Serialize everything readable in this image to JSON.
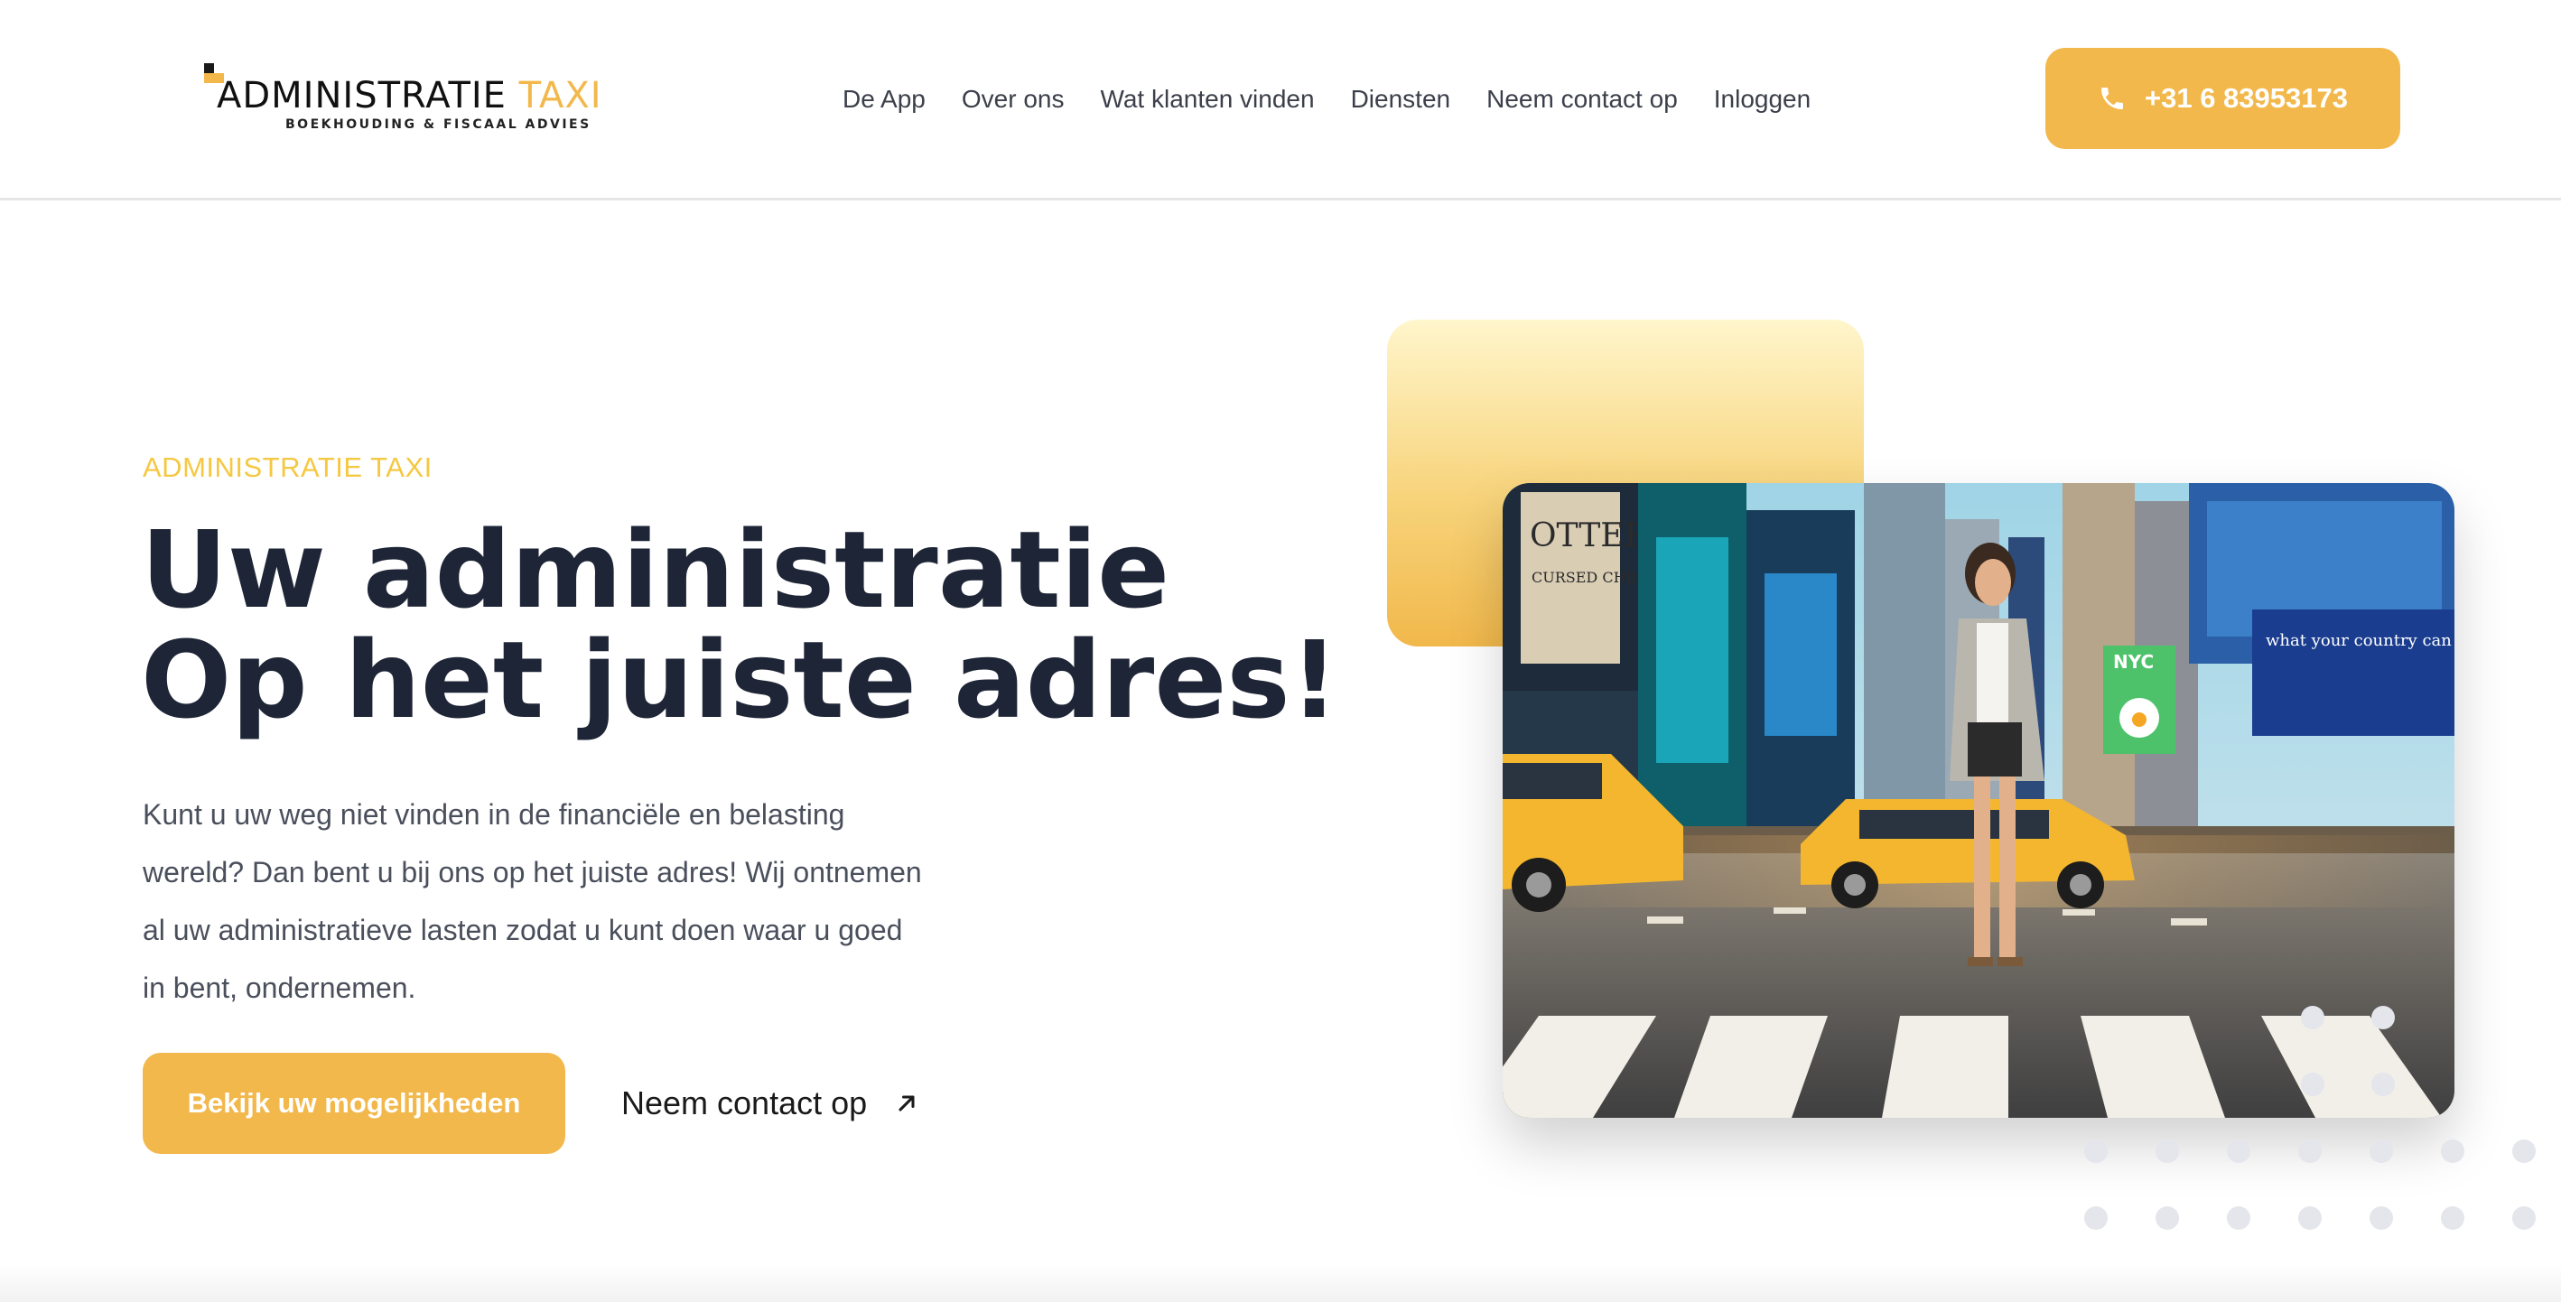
{
  "brand": {
    "name_part1": "ADMINISTRATIE",
    "name_part2": "TAXI",
    "tagline": "BOEKHOUDING & FISCAAL ADVIES",
    "accent_color": "#f2b84b"
  },
  "nav": {
    "items": [
      {
        "label": "De App"
      },
      {
        "label": "Over ons"
      },
      {
        "label": "Wat klanten vinden"
      },
      {
        "label": "Diensten"
      },
      {
        "label": "Neem contact op"
      },
      {
        "label": "Inloggen"
      }
    ]
  },
  "header": {
    "phone_label": "+31 6 83953173",
    "phone_icon": "phone-icon"
  },
  "hero": {
    "eyebrow": "ADMINISTRATIE TAXI",
    "title_line1": "Uw administratie",
    "title_line2": "Op het juiste adres!",
    "lead_lines": [
      "Kunt u uw weg niet vinden in de financiële en belasting",
      "wereld? Dan bent u bij ons op het juiste adres! Wij ontnemen",
      "al uw administratieve lasten zodat u kunt doen waar u goed",
      "in bent, ondernemen."
    ],
    "primary_cta": "Bekijk uw mogelijkheden",
    "secondary_cta": "Neem contact op",
    "secondary_icon": "arrow-up-right-icon",
    "photo_signs": {
      "billboard_left_1": "OTTER",
      "billboard_left_2": "CURSED CHILD",
      "billboard_right": "NYC",
      "billboard_text": "what your country can do"
    }
  },
  "colors": {
    "title": "#1e2536",
    "eyebrow": "#f5c842",
    "body_text": "#4a4f5c",
    "button_bg": "#f2b84b",
    "dots": "#e4e6ec"
  }
}
